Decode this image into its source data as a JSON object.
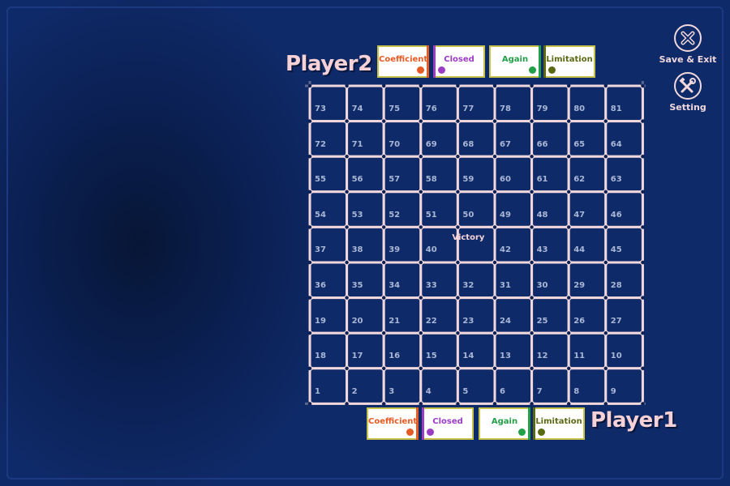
{
  "players": {
    "top": {
      "name": "Player2"
    },
    "bottom": {
      "name": "Player1"
    }
  },
  "cards": [
    {
      "label": "Coefficient",
      "color": "#e65a24"
    },
    {
      "label": "Closed",
      "color": "#9b3cc4"
    },
    {
      "label": "Again",
      "color": "#22a048"
    },
    {
      "label": "Limitation",
      "color": "#5a6a12"
    }
  ],
  "board": {
    "rows": [
      [
        "73",
        "74",
        "75",
        "76",
        "77",
        "78",
        "79",
        "80",
        "81"
      ],
      [
        "72",
        "71",
        "70",
        "69",
        "68",
        "67",
        "66",
        "65",
        "64"
      ],
      [
        "55",
        "56",
        "57",
        "58",
        "59",
        "60",
        "61",
        "62",
        "63"
      ],
      [
        "54",
        "53",
        "52",
        "51",
        "50",
        "49",
        "48",
        "47",
        "46"
      ],
      [
        "37",
        "38",
        "39",
        "40",
        "Victory",
        "42",
        "43",
        "44",
        "45"
      ],
      [
        "36",
        "35",
        "34",
        "33",
        "32",
        "31",
        "30",
        "29",
        "28"
      ],
      [
        "19",
        "20",
        "21",
        "22",
        "23",
        "24",
        "25",
        "26",
        "27"
      ],
      [
        "18",
        "17",
        "16",
        "15",
        "14",
        "13",
        "12",
        "11",
        "10"
      ],
      [
        "1",
        "2",
        "3",
        "4",
        "5",
        "6",
        "7",
        "8",
        "9"
      ]
    ],
    "victory_label": "Victory",
    "line_color": "#f1d8dc"
  },
  "menu": {
    "save_exit": "Save & Exit",
    "setting": "Setting"
  }
}
